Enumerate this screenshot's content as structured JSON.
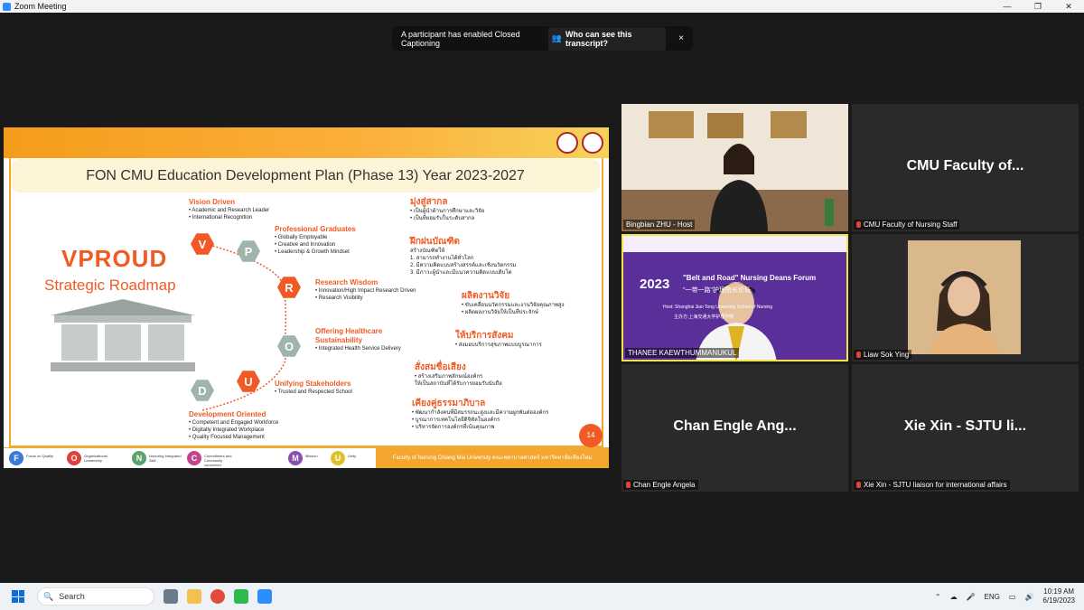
{
  "window": {
    "title": "Zoom Meeting",
    "controls": [
      "—",
      "❐",
      "✕"
    ]
  },
  "toast": {
    "message": "A participant has enabled Closed Captioning",
    "link": "Who can see this transcript?",
    "close": "×"
  },
  "slide": {
    "headline": "FON CMU Education Development Plan (Phase 13) Year 2023-2027",
    "brand": "VPROUD",
    "subtitle": "Strategic Roadmap",
    "page": "14",
    "footer": "Faculty of Nursing Chiang Mai University คณะพยาบาลศาสตร์ มหาวิทยาลัยเชียงใหม่",
    "pillars": [
      {
        "letter": "V",
        "title": "Vision Driven",
        "items": [
          "• Academic and Research Leader",
          "• International Recognition"
        ]
      },
      {
        "letter": "P",
        "title": "Professional Graduates",
        "items": [
          "• Globally Employable",
          "• Creative and Innovation",
          "• Leadership & Growth Mindset"
        ]
      },
      {
        "letter": "R",
        "title": "Research Wisdom",
        "items": [
          "• Innovation/High Impact Research Driven",
          "• Research Visibility"
        ]
      },
      {
        "letter": "O",
        "title": "Offering Healthcare Sustainability",
        "items": [
          "• Integrated Health Service Delivery"
        ]
      },
      {
        "letter": "U",
        "title": "Unifying Stakeholders",
        "items": [
          "• Trusted and Respected School"
        ]
      },
      {
        "letter": "D",
        "title": "Development Oriented",
        "items": [
          "• Competent and Engaged Workforce",
          "• Digitally Integrated Workplace",
          "• Quality Focused Management"
        ]
      }
    ],
    "thai": [
      {
        "title": "มุ่งสู่สากล",
        "items": [
          "• เป็นผู้นำด้านการศึกษาและวิจัย",
          "• เป็นที่ยอมรับในระดับสากล"
        ]
      },
      {
        "title": "ฝึกฝนบัณฑิต",
        "items": [
          "สร้างบัณฑิตให้",
          "1. สามารถทำงานได้ทั่วโลก",
          "2. มีความคิดแบบสร้างสรรค์และเชิงนวัตกรรม",
          "3. มีภาวะผู้นำและมีแนวความคิดแบบเติบโต"
        ]
      },
      {
        "title": "ผลิตงานวิจัย",
        "items": [
          "• ขับเคลื่อนนวัตกรรมและงานวิจัยคุณภาพสูง",
          "• ผลิตผลงานวิจัยให้เป็นที่ประจักษ์"
        ]
      },
      {
        "title": "ให้บริการสังคม",
        "items": [
          "• ส่งมอบบริการสุขภาพแบบบูรณาการ"
        ]
      },
      {
        "title": "สั่งสมชื่อเสียง",
        "items": [
          "• สร้างเสริมภาพลักษณ์องค์กร",
          "ให้เป็นสถาบันที่ได้รับการยอมรับนับถือ"
        ]
      },
      {
        "title": "เคียงคู่ธรรมาภิบาล",
        "items": [
          "• พัฒนากำลังคนที่มีสมรรถนะสูงและมีความผูกพันต่อองค์กร",
          "• บูรณาการเทคโนโลยีดิจิทัลในองค์กร",
          "• บริหารจัดการองค์กรที่เน้นคุณภาพ"
        ]
      }
    ],
    "bottom_letters": [
      {
        "letter": "F",
        "label": "Focus on Quality",
        "color": "#3a7bd5"
      },
      {
        "letter": "O",
        "label": "Organizational Leadership",
        "color": "#e0413c"
      },
      {
        "letter": "N",
        "label": "Nurturing Integrated Skill",
        "color": "#5aa36b"
      },
      {
        "letter": "C",
        "label": "Commitment and Community concerned",
        "color": "#c2448c"
      },
      {
        "letter": "M",
        "label": "Mission",
        "color": "#8a4fb0"
      },
      {
        "letter": "U",
        "label": "Unity",
        "color": "#e0c02a"
      }
    ]
  },
  "participants": [
    {
      "name": "Bingbian ZHU - Host",
      "big": "",
      "muted": false
    },
    {
      "name": "CMU Faculty of Nursing Staff",
      "big": "CMU Faculty of...",
      "muted": true
    },
    {
      "name": "THANEE KAEWTHUMMANUKUL",
      "big": "",
      "muted": false
    },
    {
      "name": "Liaw Sok Ying",
      "big": "",
      "muted": true
    },
    {
      "name": "Chan Engle Angela",
      "big": "Chan Engle Ang...",
      "muted": true
    },
    {
      "name": "Xie Xin - SJTU liaison for international affairs",
      "big": "Xie Xin - SJTU li...",
      "muted": true
    }
  ],
  "forum": {
    "year": "2023",
    "title": "\"Belt and Road\" Nursing Deans Forum",
    "subtitle": "\"一带一路\"护理院长论坛",
    "host": "Host: Shanghai Jiao Tong University School of Nursing",
    "host_cn": "主办方:上海交通大学护理学院"
  },
  "taskbar": {
    "search": "Search",
    "lang": "ENG",
    "time": "10:19 AM",
    "date": "6/19/2023"
  }
}
